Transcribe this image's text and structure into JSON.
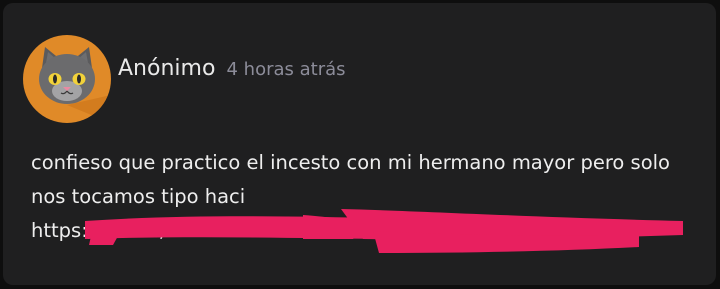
{
  "post": {
    "author": "Anónimo",
    "time": "4 horas atrás",
    "avatar": {
      "icon": "cat-face-icon",
      "bg_color": "#e08a28"
    },
    "body_lines": [
      "confieso que practico el incesto con mi hermano mayor pero solo",
      "nos tocamos tipo haci",
      "https://x.com/"
    ]
  },
  "colors": {
    "card_bg": "#1f1f20",
    "redaction": "#e8205f"
  }
}
